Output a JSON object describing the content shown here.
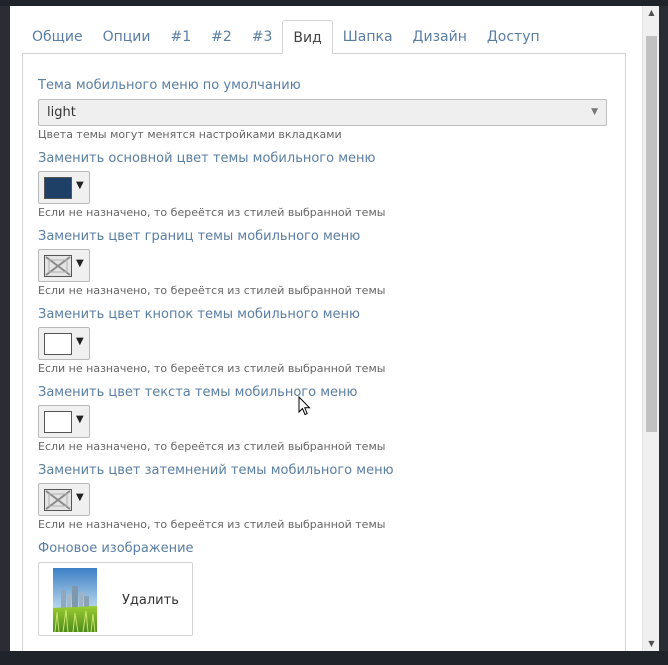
{
  "tabs": [
    {
      "label": "Общие"
    },
    {
      "label": "Опции"
    },
    {
      "label": "#1"
    },
    {
      "label": "#2"
    },
    {
      "label": "#3"
    },
    {
      "label": "Вид",
      "active": true
    },
    {
      "label": "Шапка"
    },
    {
      "label": "Дизайн"
    },
    {
      "label": "Доступ"
    }
  ],
  "theme": {
    "label": "Тема мобильного меню по умолчанию",
    "value": "light",
    "hint": "Цвета темы могут менятся настройками вкладками"
  },
  "colors": [
    {
      "label": "Заменить основной цвет темы мобильного меню",
      "swatch": "#1e3f66",
      "hint": "Если не назначено, то берeётся из стилей выбранной темы"
    },
    {
      "label": "Заменить цвет границ темы мобильного меню",
      "swatch": "none",
      "hint": "Если не назначено, то берeётся из стилей выбранной темы"
    },
    {
      "label": "Заменить цвет кнопок темы мобильного меню",
      "swatch": "#ffffff",
      "hint": "Если не назначено, то берeётся из стилей выбранной темы"
    },
    {
      "label": "Заменить цвет текста темы мобильного меню",
      "swatch": "#ffffff",
      "hint": "Если не назначено, то берeётся из стилей выбранной темы"
    },
    {
      "label": "Заменить цвет затемнений темы мобильного меню",
      "swatch": "none",
      "hint": "Если не назначено, то берeётся из стилей выбранной темы"
    }
  ],
  "background_image": {
    "label": "Фоновое изображение",
    "delete_label": "Удалить"
  },
  "accent_color": "#5a7ea3"
}
